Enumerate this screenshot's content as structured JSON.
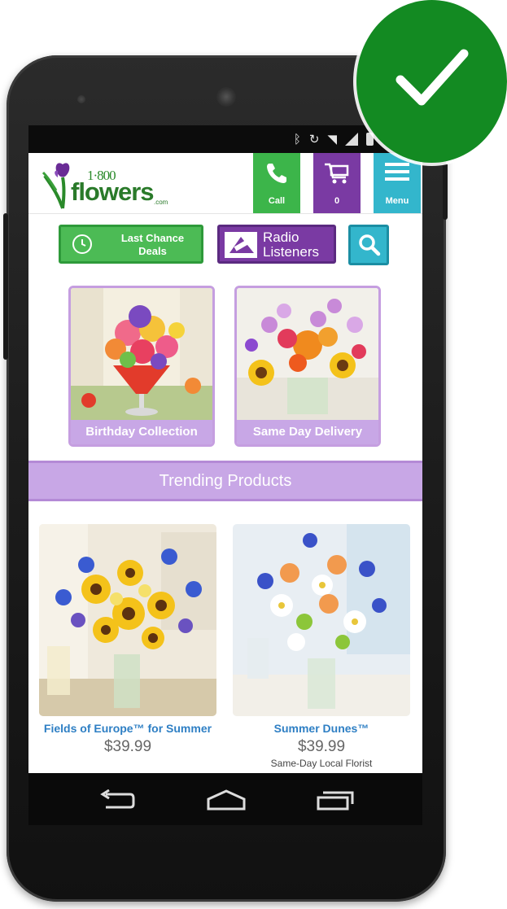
{
  "status_bar": {
    "icons": [
      "bluetooth-icon",
      "rotate-icon",
      "wifi-icon",
      "signal-icon",
      "battery-icon"
    ]
  },
  "header": {
    "logo": {
      "number": "1·800",
      "word": "flowers",
      "suffix": ".com"
    },
    "call_label": "Call",
    "cart_count": "0",
    "menu_label": "Menu"
  },
  "actions": {
    "deals_label_line1": "Last Chance",
    "deals_label_line2": "Deals",
    "radio_label_line1": "Radio",
    "radio_label_line2": "Listeners"
  },
  "categories": [
    {
      "label": "Birthday Collection"
    },
    {
      "label": "Same Day Delivery"
    }
  ],
  "trending": {
    "title": "Trending Products"
  },
  "products": [
    {
      "name": "Fields of Europe™ for Summer",
      "price": "$39.99",
      "note": ""
    },
    {
      "name": "Summer Dunes™",
      "price": "$39.99",
      "note": "Same-Day Local Florist"
    }
  ],
  "colors": {
    "green": "#3cb54a",
    "purple": "#7a3aa3",
    "teal": "#33b6cc",
    "lavender": "#c8a7e6",
    "badge_green": "#138a22"
  }
}
